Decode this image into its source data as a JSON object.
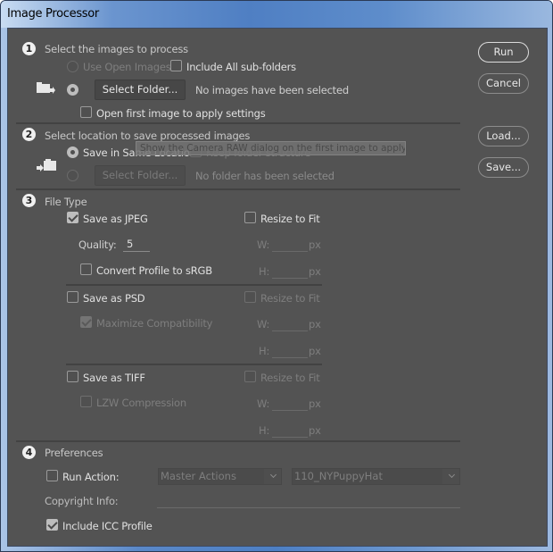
{
  "window": {
    "title": "Image Processor"
  },
  "buttons": {
    "run": "Run",
    "cancel": "Cancel",
    "load": "Load...",
    "save": "Save..."
  },
  "section1": {
    "number": "1",
    "title": "Select the images to process",
    "use_open_images": "Use Open Images",
    "include_subfolders": "Include All sub-folders",
    "select_folder": "Select Folder...",
    "status": "No images have been selected",
    "open_first_image": "Open first image to apply settings"
  },
  "section2": {
    "number": "2",
    "title": "Select location to save processed images",
    "save_same_location": "Save in Same Location",
    "keep_folder_structure": "Keep folder structure",
    "select_folder": "Select Folder...",
    "status": "No folder has been selected"
  },
  "tooltip": {
    "text": "Show the Camera RAW dialog on the first image to apply settings"
  },
  "section3": {
    "number": "3",
    "title": "File Type",
    "jpeg": {
      "label": "Save as JPEG",
      "checked": true,
      "resize": "Resize to Fit",
      "quality_label": "Quality:",
      "quality_value": "5",
      "convert_profile": "Convert Profile to sRGB",
      "w_label": "W:",
      "h_label": "H:",
      "unit": "px"
    },
    "psd": {
      "label": "Save as PSD",
      "checked": false,
      "resize": "Resize to Fit",
      "maximize": "Maximize Compatibility",
      "w_label": "W:",
      "h_label": "H:",
      "unit": "px"
    },
    "tiff": {
      "label": "Save as TIFF",
      "checked": false,
      "resize": "Resize to Fit",
      "lzw": "LZW Compression",
      "w_label": "W:",
      "h_label": "H:",
      "unit": "px"
    }
  },
  "section4": {
    "number": "4",
    "title": "Preferences",
    "run_action": "Run Action:",
    "action_set": "Master Actions",
    "action": "110_NYPuppyHat",
    "copyright_label": "Copyright Info:",
    "copyright_value": "",
    "include_icc": "Include ICC Profile"
  }
}
